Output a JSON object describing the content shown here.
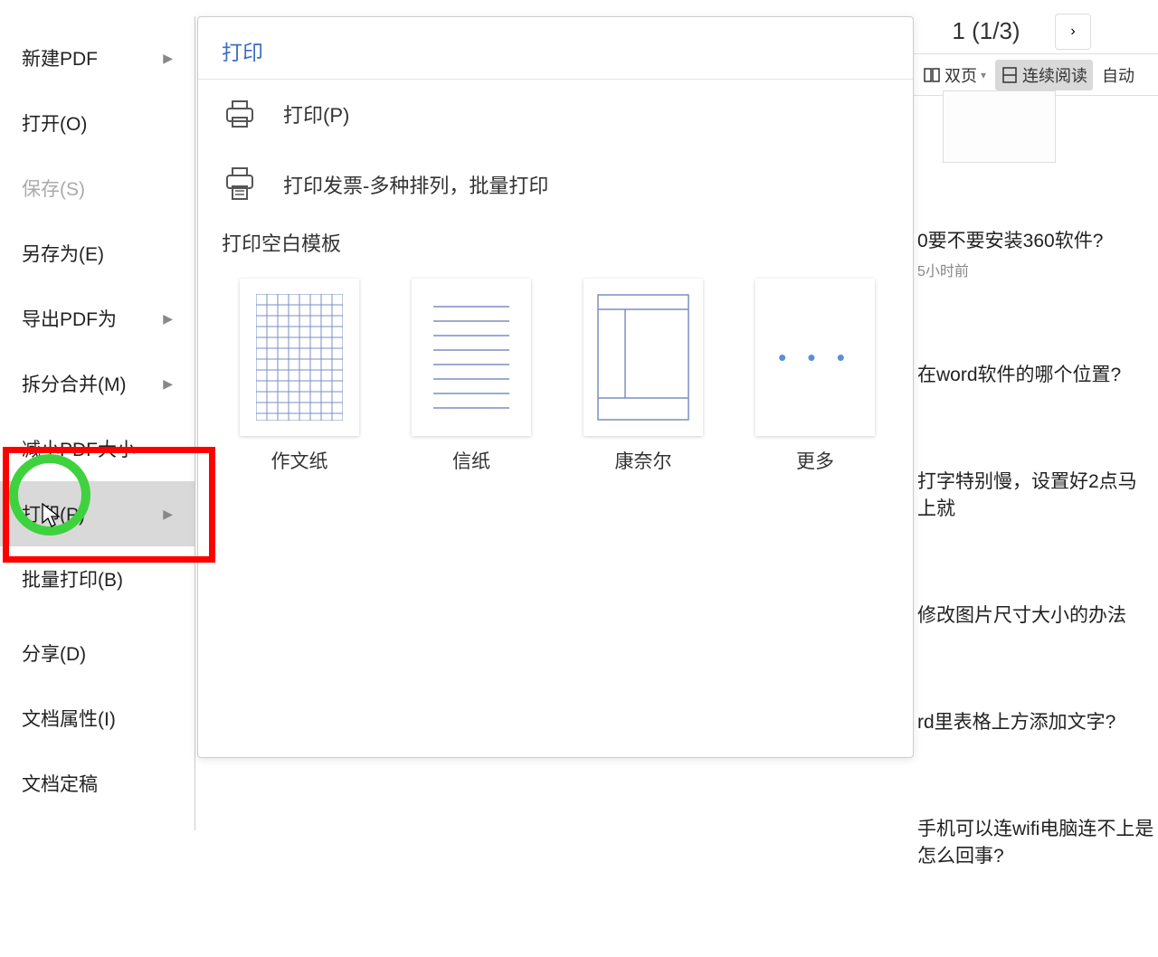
{
  "topbar": {
    "page_indicator": "1 (1/3)",
    "chevron": "›"
  },
  "toolbar": {
    "two_page": "双页",
    "continuous": "连续阅读",
    "auto": "自动"
  },
  "sidemenu": {
    "items": [
      {
        "label": "新建PDF",
        "caret": true,
        "disabled": false
      },
      {
        "label": "打开(O)",
        "caret": false,
        "disabled": false
      },
      {
        "label": "保存(S)",
        "caret": false,
        "disabled": true
      },
      {
        "label": "另存为(E)",
        "caret": false,
        "disabled": false
      },
      {
        "label": "导出PDF为",
        "caret": true,
        "disabled": false
      },
      {
        "label": "拆分合并(M)",
        "caret": true,
        "disabled": false
      },
      {
        "label": "减小PDF大小",
        "caret": false,
        "disabled": false
      },
      {
        "label": "打印(P)",
        "caret": true,
        "disabled": false,
        "highlighted": true
      },
      {
        "label": "批量打印(B)",
        "caret": false,
        "disabled": false
      },
      {
        "label": "分享(D)",
        "caret": false,
        "disabled": false
      },
      {
        "label": "文档属性(I)",
        "caret": false,
        "disabled": false
      },
      {
        "label": "文档定稿",
        "caret": false,
        "disabled": false
      }
    ]
  },
  "panel": {
    "title": "打印",
    "print_label": "打印(P)",
    "invoice_label": "打印发票-多种排列，批量打印",
    "section_title": "打印空白模板",
    "templates": [
      {
        "label": "作文纸",
        "type": "grid"
      },
      {
        "label": "信纸",
        "type": "lined"
      },
      {
        "label": "康奈尔",
        "type": "cornell"
      },
      {
        "label": "更多",
        "type": "more"
      }
    ]
  },
  "articles": [
    {
      "title": "0要不要安装360软件?",
      "meta": "5小时前"
    },
    {
      "title": "在word软件的哪个位置?",
      "meta": ""
    },
    {
      "title": "打字特别慢，设置好2点马上就",
      "meta": ""
    },
    {
      "title": "修改图片尺寸大小的办法",
      "meta": ""
    },
    {
      "title": "rd里表格上方添加文字?",
      "meta": ""
    },
    {
      "title": "手机可以连wifi电脑连不上是怎么回事?",
      "meta": ""
    }
  ]
}
